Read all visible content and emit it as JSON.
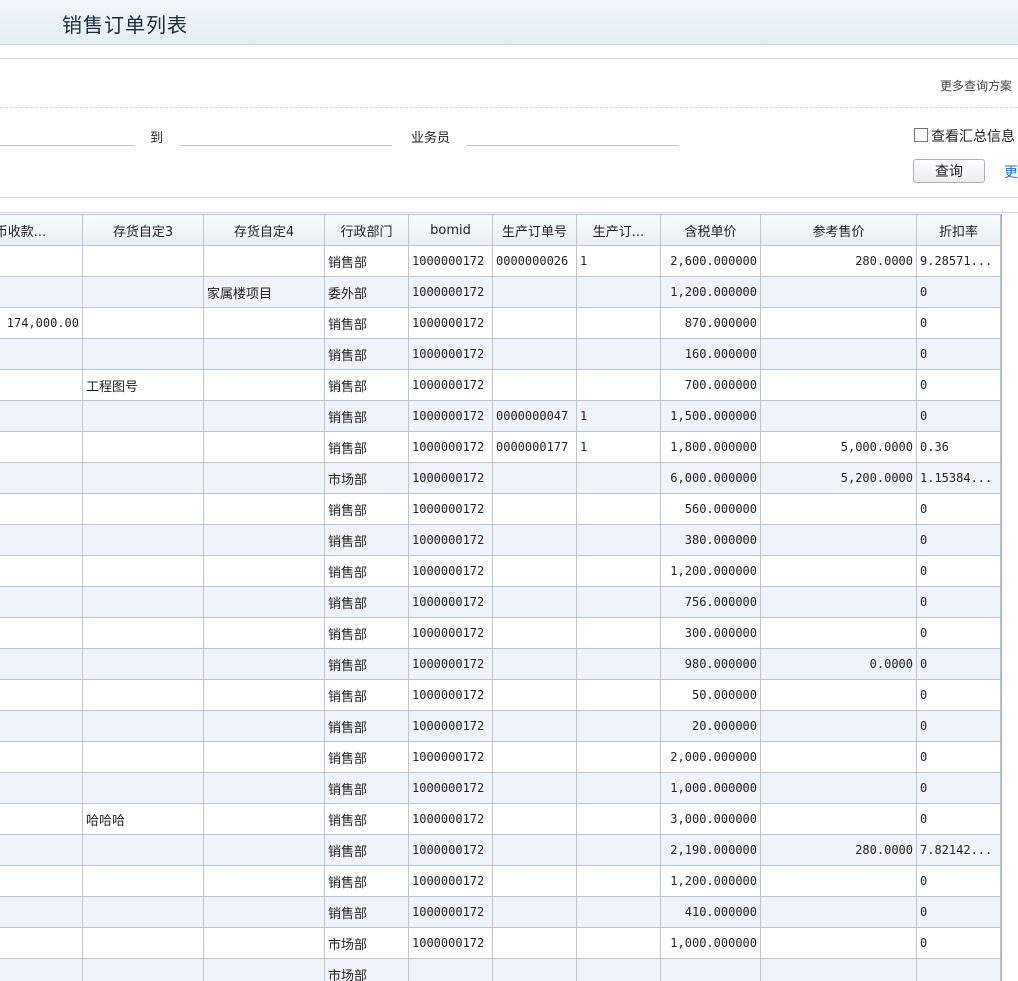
{
  "page": {
    "title": "销售订单列表"
  },
  "query": {
    "more_schemes": "更多查询方案",
    "to_label": "到",
    "salesman_label": "业务员",
    "summary_label": "查看汇总信息",
    "query_button": "查询",
    "more_link": "更多"
  },
  "grid": {
    "headers": [
      "本币收款...",
      "存货自定3",
      "存货自定4",
      "行政部门",
      "bomid",
      "生产订单号",
      "生产订...",
      "含税单价",
      "参考售价",
      "折扣率"
    ],
    "rows": [
      [
        "",
        "",
        "",
        "销售部",
        "1000000172",
        "0000000026",
        "1",
        "2,600.000000",
        "280.0000",
        "9.28571..."
      ],
      [
        "",
        "",
        "家属楼项目",
        "委外部",
        "1000000172",
        "",
        "",
        "1,200.000000",
        "",
        "0"
      ],
      [
        "174,000.00",
        "",
        "",
        "销售部",
        "1000000172",
        "",
        "",
        "870.000000",
        "",
        "0"
      ],
      [
        "",
        "",
        "",
        "销售部",
        "1000000172",
        "",
        "",
        "160.000000",
        "",
        "0"
      ],
      [
        "",
        "工程图号",
        "",
        "销售部",
        "1000000172",
        "",
        "",
        "700.000000",
        "",
        "0"
      ],
      [
        "",
        "",
        "",
        "销售部",
        "1000000172",
        "0000000047",
        "1",
        "1,500.000000",
        "",
        "0"
      ],
      [
        "",
        "",
        "",
        "销售部",
        "1000000172",
        "0000000177",
        "1",
        "1,800.000000",
        "5,000.0000",
        "0.36"
      ],
      [
        "",
        "",
        "",
        "市场部",
        "1000000172",
        "",
        "",
        "6,000.000000",
        "5,200.0000",
        "1.15384..."
      ],
      [
        "",
        "",
        "",
        "销售部",
        "1000000172",
        "",
        "",
        "560.000000",
        "",
        "0"
      ],
      [
        "",
        "",
        "",
        "销售部",
        "1000000172",
        "",
        "",
        "380.000000",
        "",
        "0"
      ],
      [
        "",
        "",
        "",
        "销售部",
        "1000000172",
        "",
        "",
        "1,200.000000",
        "",
        "0"
      ],
      [
        "",
        "",
        "",
        "销售部",
        "1000000172",
        "",
        "",
        "756.000000",
        "",
        "0"
      ],
      [
        "",
        "",
        "",
        "销售部",
        "1000000172",
        "",
        "",
        "300.000000",
        "",
        "0"
      ],
      [
        "",
        "",
        "",
        "销售部",
        "1000000172",
        "",
        "",
        "980.000000",
        "0.0000",
        "0"
      ],
      [
        "",
        "",
        "",
        "销售部",
        "1000000172",
        "",
        "",
        "50.000000",
        "",
        "0"
      ],
      [
        "",
        "",
        "",
        "销售部",
        "1000000172",
        "",
        "",
        "20.000000",
        "",
        "0"
      ],
      [
        "",
        "",
        "",
        "销售部",
        "1000000172",
        "",
        "",
        "2,000.000000",
        "",
        "0"
      ],
      [
        "",
        "",
        "",
        "销售部",
        "1000000172",
        "",
        "",
        "1,000.000000",
        "",
        "0"
      ],
      [
        "",
        "哈哈哈",
        "",
        "销售部",
        "1000000172",
        "",
        "",
        "3,000.000000",
        "",
        "0"
      ],
      [
        "",
        "",
        "",
        "销售部",
        "1000000172",
        "",
        "",
        "2,190.000000",
        "280.0000",
        "7.82142..."
      ],
      [
        "",
        "",
        "",
        "销售部",
        "1000000172",
        "",
        "",
        "1,200.000000",
        "",
        "0"
      ],
      [
        "",
        "",
        "",
        "销售部",
        "1000000172",
        "",
        "",
        "410.000000",
        "",
        "0"
      ],
      [
        "",
        "",
        "",
        "市场部",
        "1000000172",
        "",
        "",
        "1,000.000000",
        "",
        "0"
      ],
      [
        "",
        "",
        "",
        "市场部",
        "",
        "",
        "",
        "",
        "",
        ""
      ]
    ]
  }
}
